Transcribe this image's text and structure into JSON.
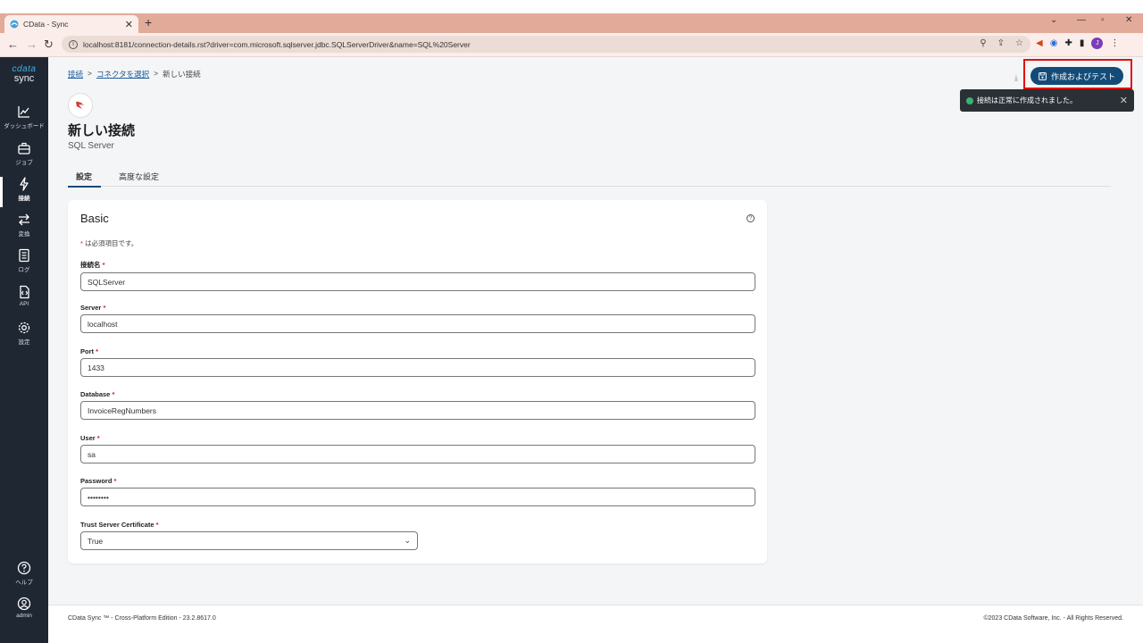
{
  "browser": {
    "tab_title": "CData - Sync",
    "url": "localhost:8181/connection-details.rst?driver=com.microsoft.sqlserver.jdbc.SQLServerDriver&name=SQL%20Server",
    "ext_avatar": "J"
  },
  "sidebar": {
    "logo_top": "cdata",
    "logo_bottom": "sync",
    "items": [
      {
        "label": "ダッシュボード",
        "icon": "chart-icon"
      },
      {
        "label": "ジョブ",
        "icon": "briefcase-icon"
      },
      {
        "label": "接続",
        "icon": "bolt-icon"
      },
      {
        "label": "変換",
        "icon": "transform-icon"
      },
      {
        "label": "ログ",
        "icon": "log-icon"
      },
      {
        "label": "API",
        "icon": "api-icon"
      },
      {
        "label": "設定",
        "icon": "gear-icon"
      }
    ],
    "bottom": [
      {
        "label": "ヘルプ",
        "icon": "help-icon"
      },
      {
        "label": "admin",
        "icon": "user-icon"
      }
    ]
  },
  "breadcrumb": {
    "items": [
      "接続",
      "コネクタを選択",
      "新しい接続"
    ],
    "sep": ">"
  },
  "page": {
    "title": "新しい接続",
    "subtitle": "SQL Server",
    "tabs": [
      "設定",
      "高度な設定"
    ]
  },
  "card": {
    "title": "Basic",
    "required_note_star": "*",
    "required_note": " は必須項目です。",
    "fields": [
      {
        "label": "接続名",
        "value": "SQLServer"
      },
      {
        "label": "Server",
        "value": "localhost"
      },
      {
        "label": "Port",
        "value": "1433"
      },
      {
        "label": "Database",
        "value": "InvoiceRegNumbers"
      },
      {
        "label": "User",
        "value": "sa"
      },
      {
        "label": "Password",
        "value": "••••••••"
      },
      {
        "label": "Trust Server Certificate",
        "value": "True"
      }
    ],
    "star": "*"
  },
  "actions": {
    "create_test_label": "作成およびテスト",
    "toast_message": "接続は正常に作成されました。"
  },
  "footer": {
    "left": "CData Sync ™ - Cross-Platform Edition - 23.2.8617.0",
    "right": "©2023 CData Software, Inc. - All Rights Reserved."
  },
  "colors": {
    "tabbar": "#e2aa98",
    "sidebar": "#1f2733",
    "primary_button": "#124b78",
    "highlight_box": "#e01010",
    "toast": "#2a3036"
  }
}
